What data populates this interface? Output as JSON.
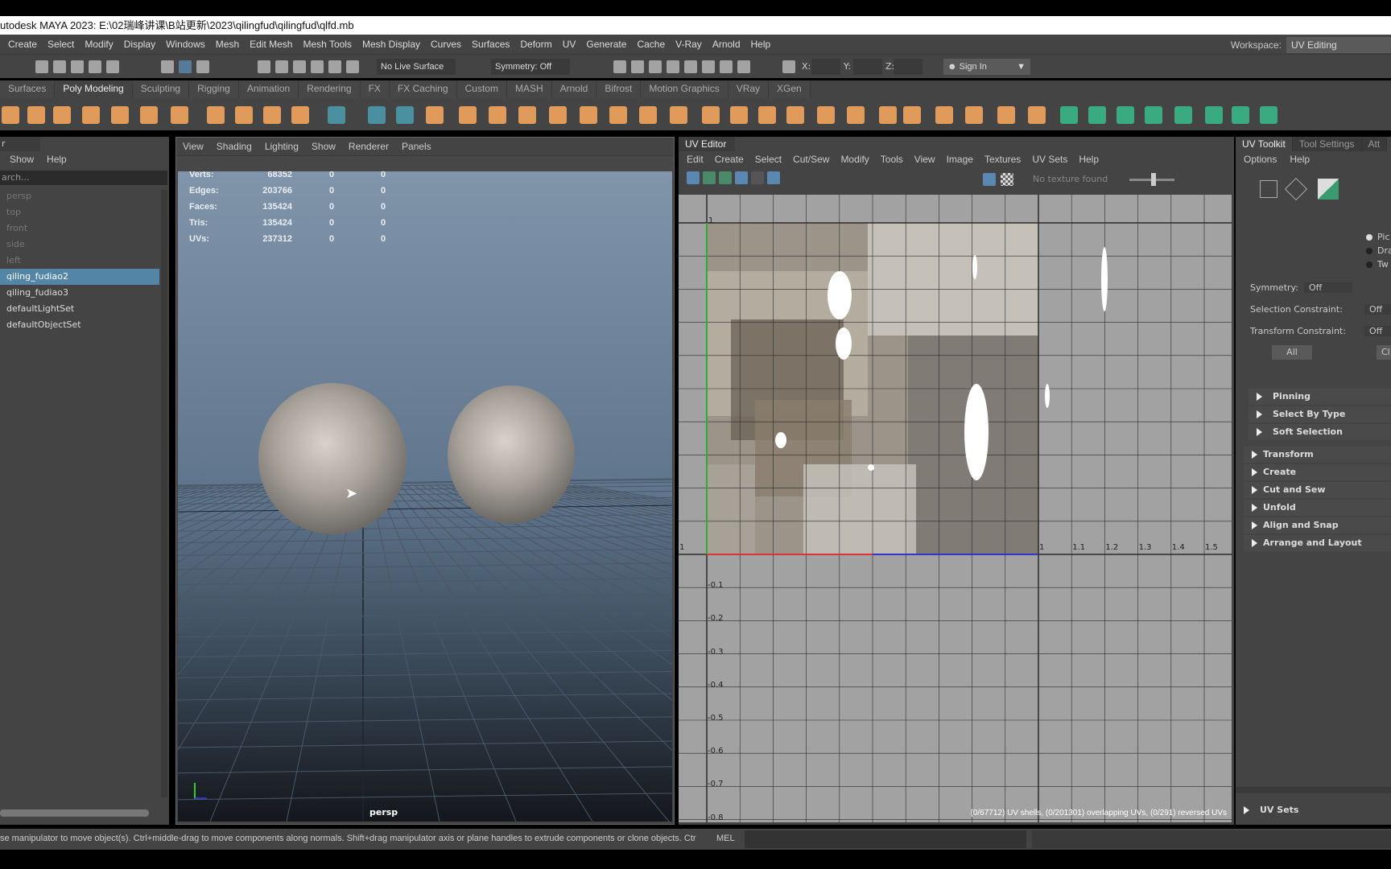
{
  "window": {
    "title": "utodesk MAYA 2023: E:\\02瑞峰讲课\\B站更新\\2023\\qilingfud\\qilingfud\\qlfd.mb"
  },
  "menu": [
    "Create",
    "Select",
    "Modify",
    "Display",
    "Windows",
    "Mesh",
    "Edit Mesh",
    "Mesh Tools",
    "Mesh Display",
    "Curves",
    "Surfaces",
    "Deform",
    "UV",
    "Generate",
    "Cache",
    "V-Ray",
    "Arnold",
    "Help"
  ],
  "workspace": {
    "label": "Workspace:",
    "value": "UV Editing"
  },
  "toolbar": {
    "live_surface": "No Live Surface",
    "symmetry": "Symmetry: Off",
    "x": "X:",
    "y": "Y:",
    "z": "Z:",
    "sign_in": "Sign In"
  },
  "shelf_tabs": [
    "Surfaces",
    "Poly Modeling",
    "Sculpting",
    "Rigging",
    "Animation",
    "Rendering",
    "FX",
    "FX Caching",
    "Custom",
    "MASH",
    "Arnold",
    "Bifrost",
    "Motion Graphics",
    "VRay",
    "XGen"
  ],
  "shelf_active": "Poly Modeling",
  "outliner": {
    "title": "r",
    "menu": [
      "Show",
      "Help"
    ],
    "search_placeholder": "arch...",
    "items": [
      {
        "label": "persp",
        "dim": true
      },
      {
        "label": "top",
        "dim": true
      },
      {
        "label": "front",
        "dim": true
      },
      {
        "label": "side",
        "dim": true
      },
      {
        "label": "left",
        "dim": true
      },
      {
        "label": "qiling_fudiao2",
        "selected": true
      },
      {
        "label": "qiling_fudiao3"
      },
      {
        "label": "defaultLightSet"
      },
      {
        "label": "defaultObjectSet"
      }
    ]
  },
  "viewport": {
    "menu": [
      "View",
      "Shading",
      "Lighting",
      "Show",
      "Renderer",
      "Panels"
    ],
    "camera": "persp",
    "stats": [
      {
        "label": "Verts:",
        "v": "68352",
        "a": "0",
        "b": "0"
      },
      {
        "label": "Edges:",
        "v": "203766",
        "a": "0",
        "b": "0"
      },
      {
        "label": "Faces:",
        "v": "135424",
        "a": "0",
        "b": "0"
      },
      {
        "label": "Tris:",
        "v": "135424",
        "a": "0",
        "b": "0"
      },
      {
        "label": "UVs:",
        "v": "237312",
        "a": "0",
        "b": "0"
      }
    ]
  },
  "uv_editor": {
    "tab": "UV Editor",
    "menu": [
      "Edit",
      "Create",
      "Select",
      "Cut/Sew",
      "Modify",
      "Tools",
      "View",
      "Image",
      "Textures",
      "UV Sets",
      "Help"
    ],
    "texture": "No texture found",
    "u_labels": [
      ".1",
      "1",
      "1.1",
      "1.2",
      "1.3",
      "1.4",
      "1.5"
    ],
    "v_top": "1",
    "v_labels": [
      "-0.1",
      "-0.2",
      "-0.3",
      "-0.4",
      "-0.5",
      "-0.6",
      "-0.7",
      "-0.8"
    ],
    "info": "(0/67712) UV shells, (0/201301) overlapping UVs, (0/291) reversed UVs"
  },
  "toolkit": {
    "tabs": [
      "UV Toolkit",
      "Tool Settings",
      "Att"
    ],
    "menu": [
      "Options",
      "Help"
    ],
    "radio": [
      "Pic",
      "Dra",
      "Tw"
    ],
    "symmetry": {
      "label": "Symmetry:",
      "value": "Off"
    },
    "selection_constraint": {
      "label": "Selection Constraint:",
      "value": "Off"
    },
    "transform_constraint": {
      "label": "Transform Constraint:",
      "value": "Off"
    },
    "buttons": [
      "All",
      "Cl"
    ],
    "sub_sections": [
      "Pinning",
      "Select By Type",
      "Soft Selection"
    ],
    "sections": [
      "Transform",
      "Create",
      "Cut and Sew",
      "Unfold",
      "Align and Snap",
      "Arrange and Layout"
    ],
    "uv_sets": "UV Sets"
  },
  "status": {
    "help": "se manipulator to move object(s). Ctrl+middle-drag to move components along normals. Shift+drag manipulator axis or plane handles to extrude components or clone objects. Ctrl+Shift+drag to c",
    "mel": "MEL"
  },
  "colors": {
    "accent": "#5285a6",
    "shelf_icon": "#e09a5a",
    "panel_bg": "#444444",
    "uv_bg": "#a2a2a2"
  }
}
